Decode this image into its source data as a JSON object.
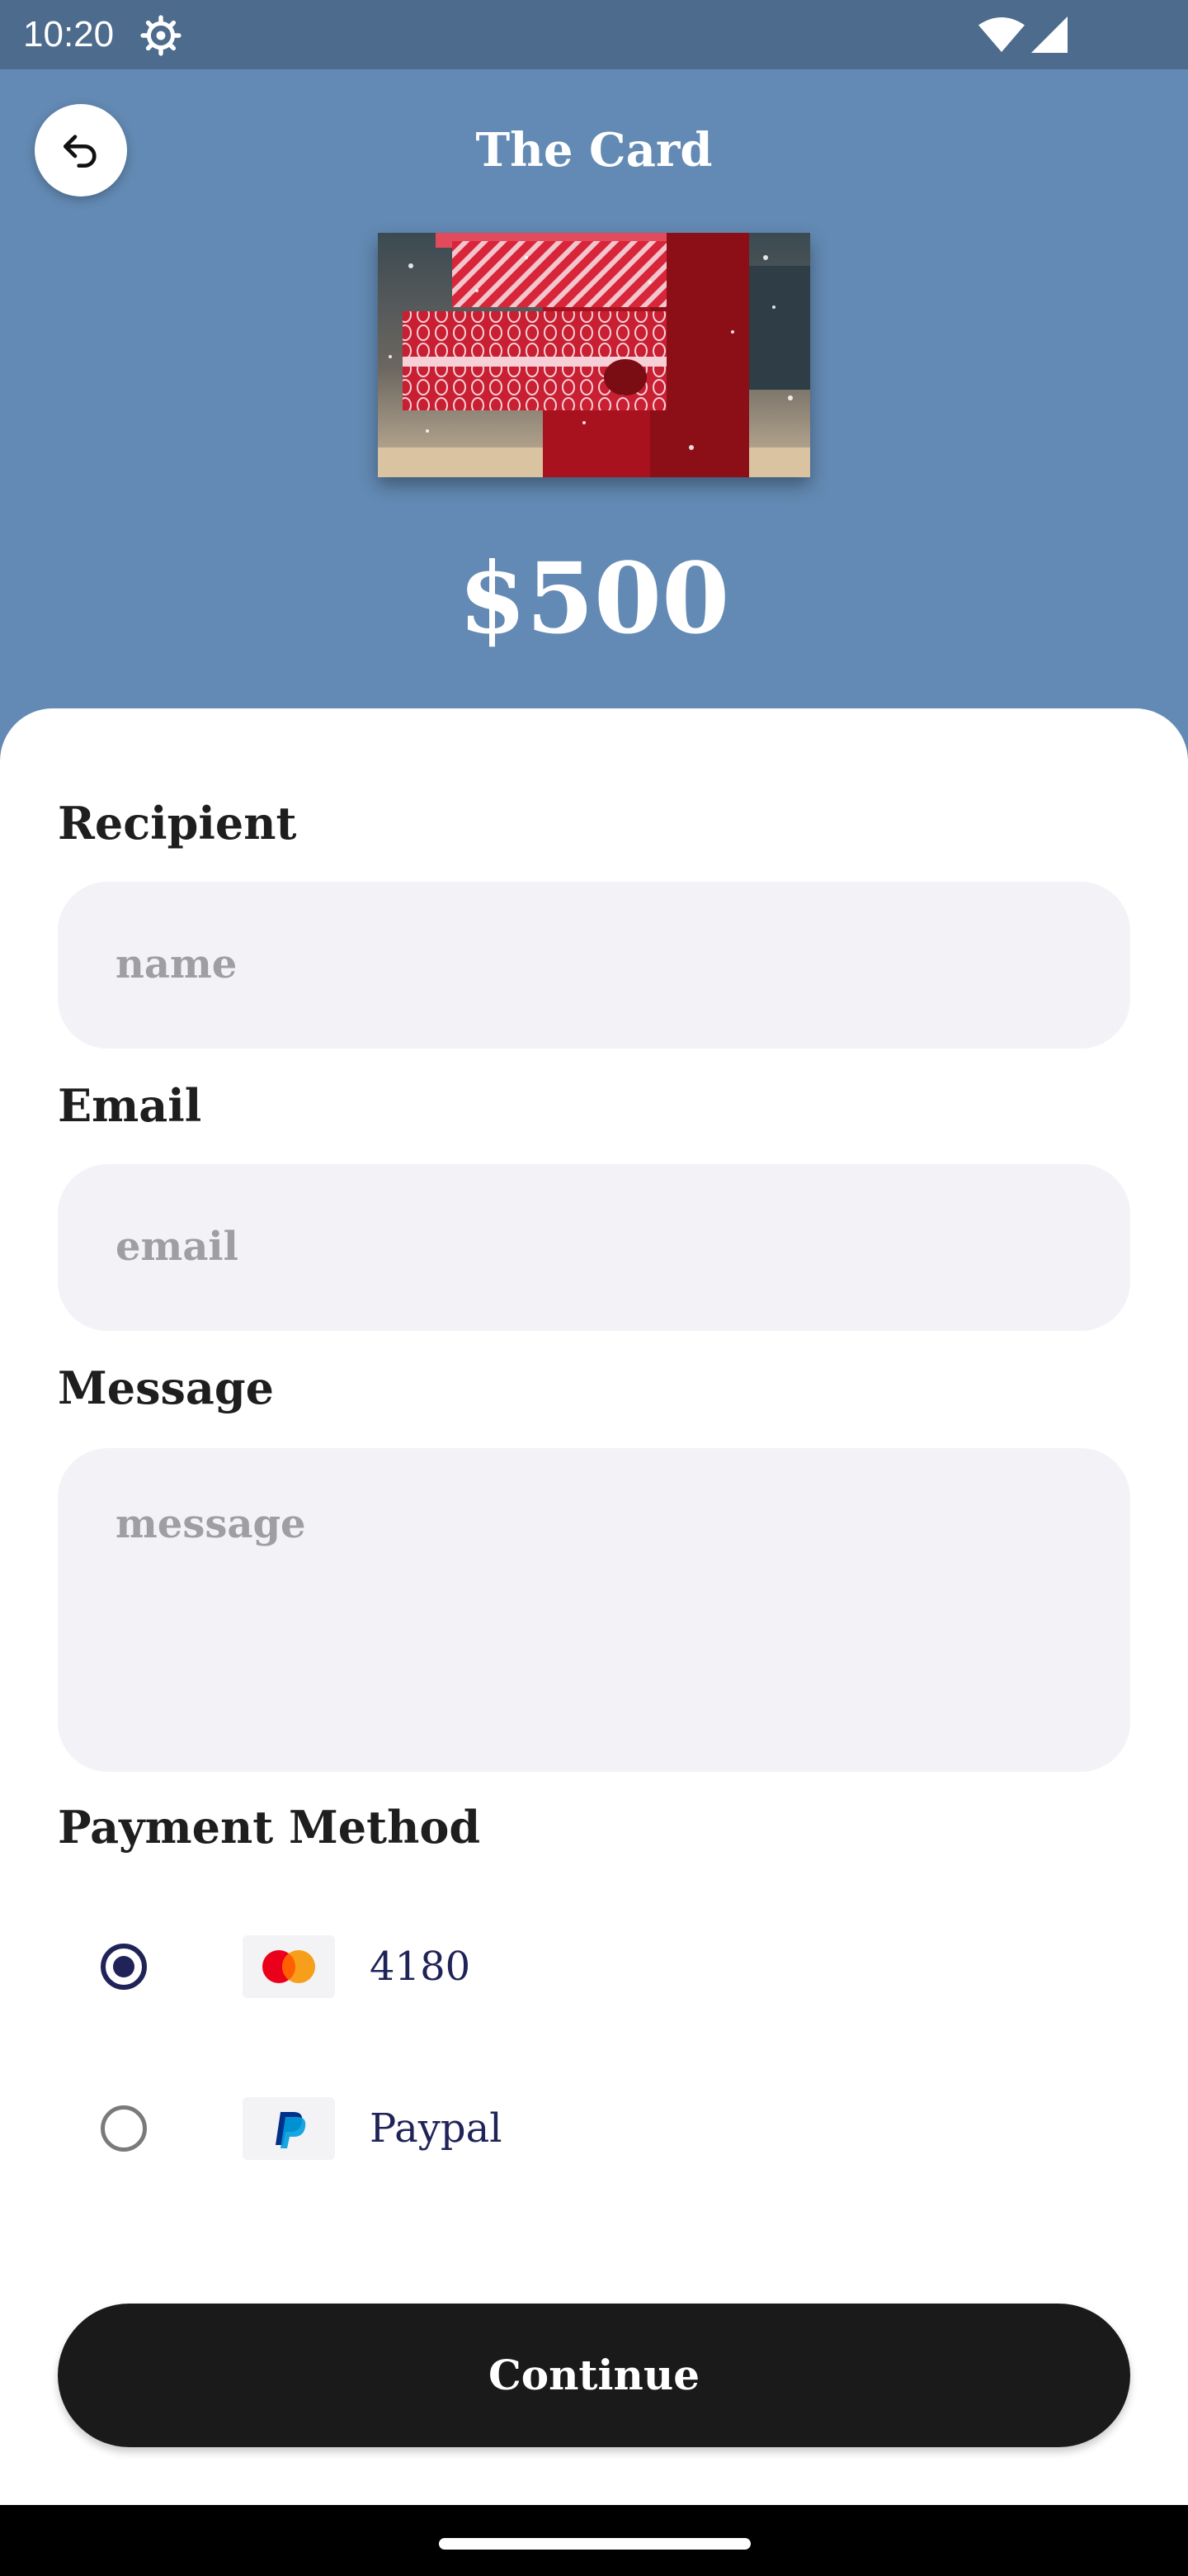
{
  "status_bar": {
    "time": "10:20"
  },
  "header": {
    "title": "The Card"
  },
  "card": {
    "amount": "$500"
  },
  "form": {
    "recipient": {
      "label": "Recipient",
      "placeholder": "name"
    },
    "email": {
      "label": "Email",
      "placeholder": "email"
    },
    "message": {
      "label": "Message",
      "placeholder": "message"
    }
  },
  "payment": {
    "label": "Payment Method",
    "options": [
      {
        "label": "4180",
        "icon": "mastercard-icon",
        "selected": true
      },
      {
        "label": "Paypal",
        "icon": "paypal-icon",
        "selected": false
      }
    ]
  },
  "continue_label": "Continue",
  "colors": {
    "header_bg": "#638ab4",
    "status_bg": "#4d6b8c",
    "input_bg": "#f3f3f7",
    "button_bg": "#1a1a1a",
    "radio_accent": "#1f2357"
  }
}
